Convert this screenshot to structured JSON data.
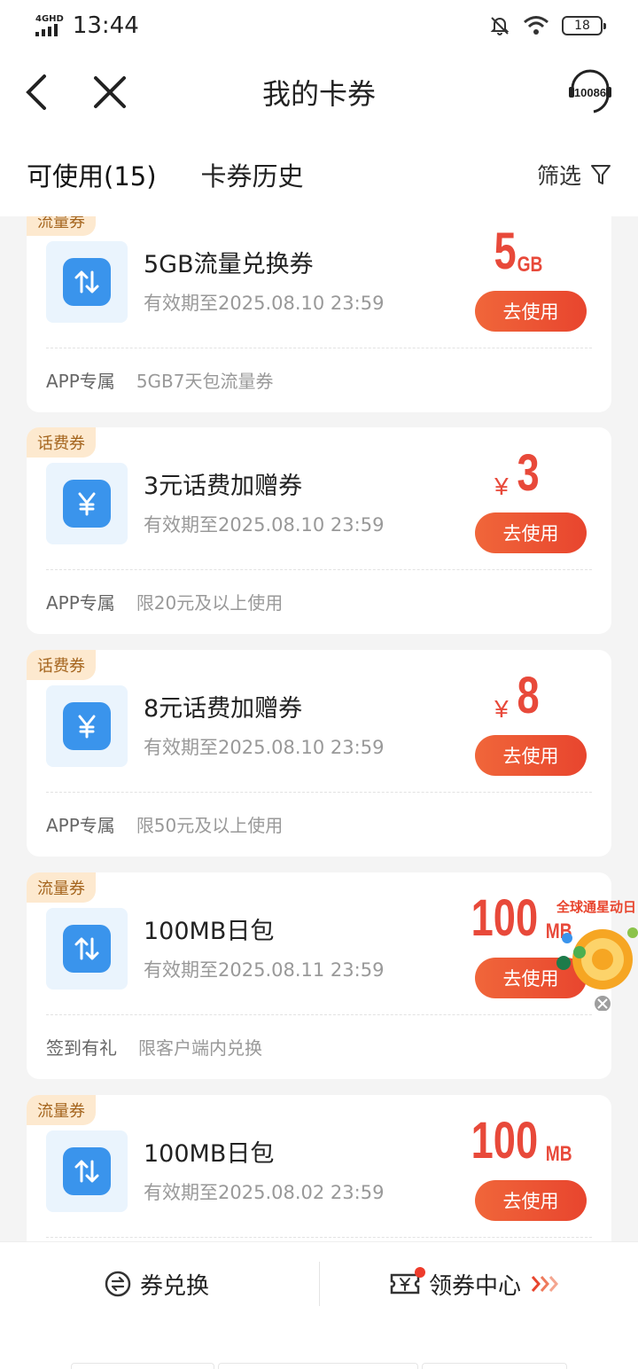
{
  "status_bar": {
    "network": "4GHD",
    "time": "13:44",
    "battery": "18"
  },
  "header": {
    "title": "我的卡券",
    "service_label": "10086"
  },
  "tabs": {
    "available": "可使用(15)",
    "history": "卡券历史",
    "filter": "筛选"
  },
  "coupons": [
    {
      "tag": "流量券",
      "name": "5GB流量兑换券",
      "expiry": "有效期至2025.08.10 23:59",
      "amount": "5",
      "unit": "GB",
      "currency": "",
      "button": "去使用",
      "source": "APP专属",
      "desc": "5GB7天包流量券",
      "icon": "data-arrows-icon"
    },
    {
      "tag": "话费券",
      "name": "3元话费加赠券",
      "expiry": "有效期至2025.08.10 23:59",
      "amount": "3",
      "unit": "",
      "currency": "¥",
      "button": "去使用",
      "source": "APP专属",
      "desc": "限20元及以上使用",
      "icon": "yuan-icon"
    },
    {
      "tag": "话费券",
      "name": "8元话费加赠券",
      "expiry": "有效期至2025.08.10 23:59",
      "amount": "8",
      "unit": "",
      "currency": "¥",
      "button": "去使用",
      "source": "APP专属",
      "desc": "限50元及以上使用",
      "icon": "yuan-icon"
    },
    {
      "tag": "流量券",
      "name": "100MB日包",
      "expiry": "有效期至2025.08.11 23:59",
      "amount": "100",
      "unit": "MB",
      "currency": "",
      "button": "去使用",
      "source": "签到有礼",
      "desc": "限客户端内兑换",
      "icon": "data-arrows-icon"
    },
    {
      "tag": "流量券",
      "name": "100MB日包",
      "expiry": "有效期至2025.08.02 23:59",
      "amount": "100",
      "unit": "MB",
      "currency": "",
      "button": "去使用",
      "source": "",
      "desc": "",
      "icon": "data-arrows-icon"
    }
  ],
  "float_ad": {
    "text": "全球通星动日"
  },
  "bottom_bar": {
    "exchange": "券兑换",
    "center": "领券中心"
  },
  "colors": {
    "accent": "#e8493a",
    "tag_bg": "#fde9cf",
    "icon_blue": "#3a94ec"
  }
}
